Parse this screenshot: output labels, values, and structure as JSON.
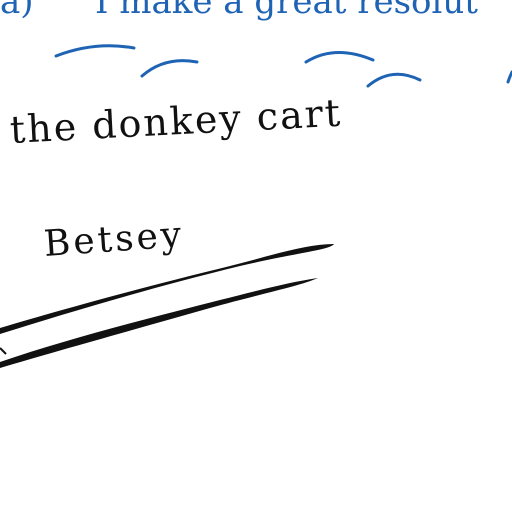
{
  "heading": {
    "prefix": "a)",
    "text": "I make a great resolut"
  },
  "captions": {
    "line1": "the donkey cart",
    "line2": "Betsey"
  },
  "colors": {
    "ink_blue": "#1f63b5",
    "ink_black": "#111111"
  }
}
